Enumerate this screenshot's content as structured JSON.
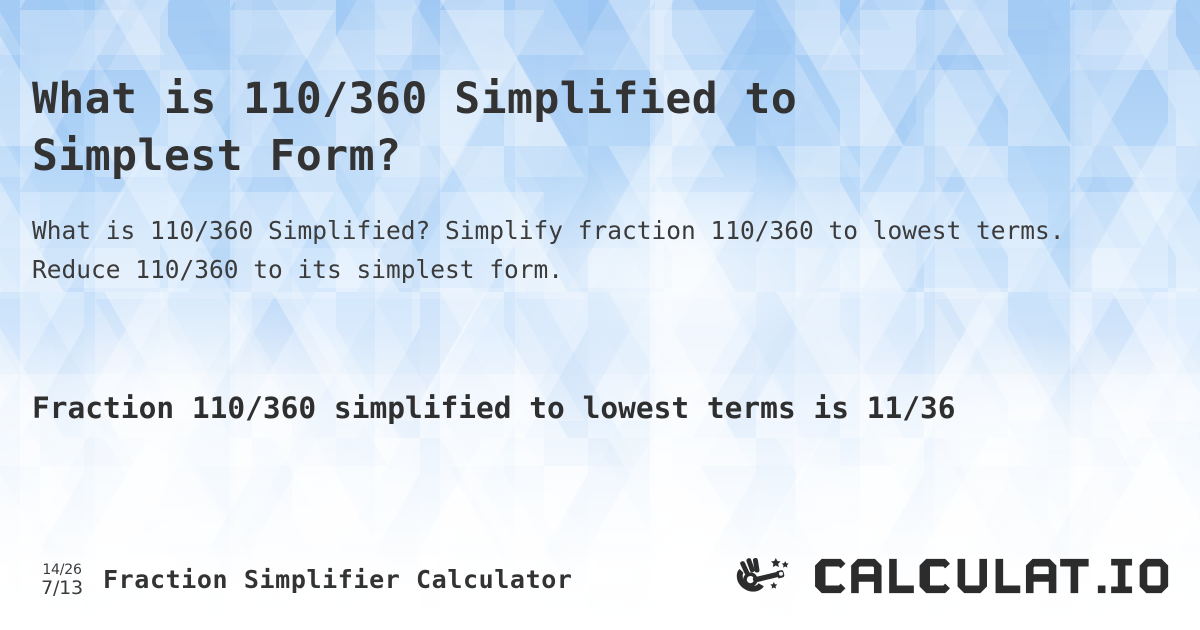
{
  "page": {
    "title_line1": "What is 110/360 Simplified to",
    "title_line2": "Simplest Form?",
    "title_full": "What is 110/360 Simplified to Simplest Form?",
    "subtitle": "What is 110/360 Simplified? Simplify fraction 110/360 to lowest terms. Reduce 110/360 to its simplest form.",
    "answer": "Fraction 110/360 simplified to lowest terms is 11/36"
  },
  "math": {
    "fraction": "110/360",
    "numerator": 110,
    "denominator": 360,
    "simplified": "11/36",
    "simplified_numerator": 11,
    "simplified_denominator": 36
  },
  "footer": {
    "icon_top": "14/26",
    "icon_bottom": "7/13",
    "label": "Fraction Simplifier Calculator",
    "brand": "CALCULAT.IO",
    "brand_icon": "magic-wand-hand-icon"
  },
  "colors": {
    "background_top": "#a9cef5",
    "background_bottom": "#ffffff",
    "title_text": "#333333",
    "subtitle_text": "#3b3b3b",
    "answer_text": "#2f2f2f",
    "brand_text": "#2c2c2c"
  }
}
